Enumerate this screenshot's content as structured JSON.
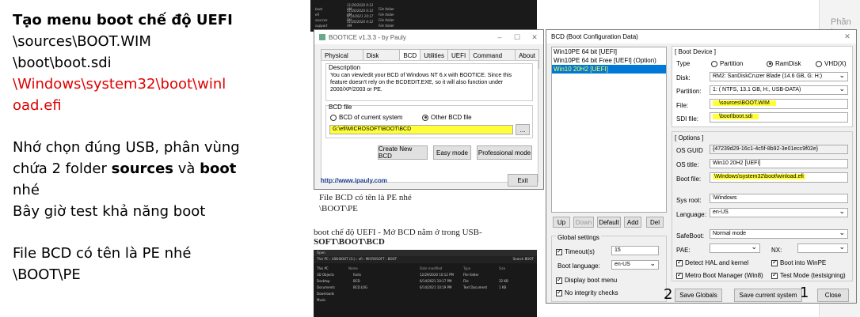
{
  "notes": {
    "title": "Tạo menu boot chế độ UEFI",
    "path1": "\\sources\\BOOT.WIM",
    "path2": "\\boot\\boot.sdi",
    "path3a": "\\Windows\\system32\\boot\\winl",
    "path3b": "oad.efi",
    "usb_a": "Nhớ chọn đúng USB, phân vùng",
    "usb_b1": "chứa 2 folder ",
    "usb_b2": "sources",
    "usb_b3": " và ",
    "usb_b4": "boot",
    "usb_c": "nhé",
    "test": "Bây giờ test khả năng boot",
    "bcd_name": "File BCD có tên là PE nhé",
    "bcd_path": "\\BOOT\\PE"
  },
  "right_panel": {
    "label": "Phần ta"
  },
  "doc": {
    "caption1": "File BCD có tên là PE nhé",
    "caption2": "\\BOOT\\PE",
    "line1": "boot chế độ UEFI - Mở BCD nằm ở trong USB-",
    "line2": "SOFT\\BOOT\\BCD"
  },
  "explorer_top": {
    "rows": [
      [
        "boot",
        "11/20/2020 6:12 AM",
        "File folder"
      ],
      [
        "efi",
        "11/20/2020 6:12 AM",
        "File folder"
      ],
      [
        "sources",
        "6/14/2021 10:17 PM",
        "File folder"
      ],
      [
        "support",
        "11/20/2020 6:12 AM",
        "File folder"
      ]
    ]
  },
  "explorer_bottom": {
    "title": "Open",
    "path": "This PC › USB-BOOT (G:) › efi › MICROSOFT › BOOT",
    "search": "Search BOOT",
    "nav": [
      "This PC",
      "3D Objects",
      "Desktop",
      "Documents",
      "Downloads",
      "Music"
    ],
    "headers": [
      "Name",
      "Date modified",
      "Type",
      "Size"
    ],
    "files": [
      [
        "fonts",
        "12/29/2020 10:12 PM",
        "File folder",
        ""
      ],
      [
        "BCD",
        "6/14/2021 10:17 PM",
        "File",
        "32 KB"
      ],
      [
        "BCD.LOG",
        "6/14/2021 10:19 PM",
        "Text Document",
        "1 KB"
      ]
    ]
  },
  "bootice": {
    "title": "BOOTICE v1.3.3 - by Pauly",
    "tabs": [
      "Physical disk",
      "Disk image",
      "BCD",
      "Utilities",
      "UEFI",
      "Command line",
      "About"
    ],
    "desc_label": "Description",
    "desc_text": "You can view/edit your BCD of Windows NT 6.x with BOOTICE. Since this feature doesn't rely on the BCDEDIT.EXE, so it will also function under 2000/XP/2003 or PE.",
    "bcdfile_label": "BCD file",
    "radio_current": "BCD of current system",
    "radio_other": "Other BCD file",
    "bcd_path": "G:\\efi\\MICROSOFT\\BOOT\\BCD",
    "browse": "...",
    "btn_create": "Create New BCD",
    "btn_easy": "Easy mode",
    "btn_pro": "Professional mode",
    "link": "http://www.ipauly.com",
    "btn_exit": "Exit"
  },
  "bcd": {
    "title": "BCD (Boot Configuration Data)",
    "close": "✕",
    "entries": [
      "Win10PE 64 bit [UEFI]",
      "Win10PE 64 bit Free [UEFI] (Option)",
      "Win10 20H2 [UEFI]"
    ],
    "btn_up": "Up",
    "btn_down": "Down",
    "btn_default": "Default",
    "btn_add": "Add",
    "btn_del": "Del",
    "global_label": "Global settings",
    "timeout_label": "Timeout(s)",
    "timeout_value": "15",
    "lang_label": "Boot language:",
    "lang_value": "en-US",
    "display_menu": "Display boot menu",
    "no_integrity": "No integrity checks",
    "btn_save_globals": "Save Globals",
    "btn_save_current": "Save current system",
    "btn_close": "Close",
    "device_label": "[ Boot Device ]",
    "type_label": "Type",
    "type_partition": "Partition",
    "type_ramdisk": "RamDisk",
    "type_vhd": "VHD(X)",
    "disk_label": "Disk:",
    "disk_value": "RM2: SanDiskCruzer Blade (14.6 GB, G: H:)",
    "part_label": "Partition:",
    "part_value": "1: ( NTFS,  13.1 GB, H:, USB-DATA)",
    "file_label": "File:",
    "file_value": "\\sources\\BOOT.WIM",
    "sdi_label": "SDI file:",
    "sdi_value": "\\boot\\boot.sdi",
    "options_label": "[ Options ]",
    "guid_label": "OS GUID",
    "guid_value": "{47239d29-16c1-4c5f-8b92-3e01ecc9f02e}",
    "ostitle_label": "OS title:",
    "ostitle_value": "Win10 20H2 [UEFI]",
    "bootfile_label": "Boot file:",
    "bootfile_value": "\\Windows\\system32\\boot\\winload.efi",
    "sysroot_label": "Sys root:",
    "sysroot_value": "\\Windows",
    "language_label": "Language:",
    "language_value": "en-US",
    "safeboot_label": "SafeBoot:",
    "safeboot_value": "Normal mode",
    "pae_label": "PAE:",
    "nx_label": "NX:",
    "hal_label": "Detect HAL and kernel",
    "winpe_label": "Boot into WinPE",
    "metro_label": "Metro Boot Manager (Win8)",
    "testmode_label": "Test Mode (testsigning)"
  },
  "annot": {
    "one": "1",
    "two": "2"
  },
  "colors": {
    "highlight": "#ffff3a",
    "selected": "#0078d7",
    "red": "#e00000"
  }
}
